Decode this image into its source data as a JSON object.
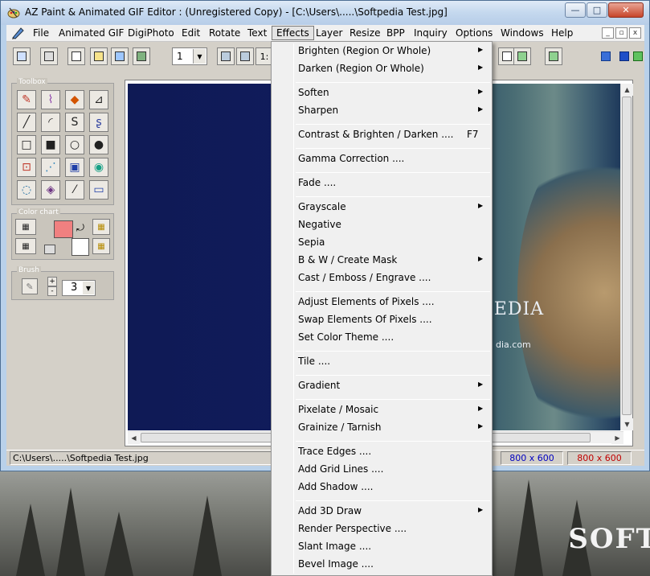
{
  "window": {
    "title": "AZ Paint & Animated GIF Editor : (Unregistered Copy) - [C:\\Users\\.....\\Softpedia Test.jpg]",
    "controls": {
      "minimize": "—",
      "maximize": "□",
      "close": "✕"
    }
  },
  "menubar": {
    "items": [
      "File",
      "Animated GIF",
      "DigiPhoto",
      "Edit",
      "Rotate",
      "Text",
      "Effects",
      "Layer",
      "Resize",
      "BPP",
      "Inquiry",
      "Options",
      "Windows",
      "Help"
    ],
    "active": "Effects",
    "mdi": {
      "minimize": "_",
      "restore": "▫",
      "close": "x"
    }
  },
  "toolbar": {
    "frame_select_value": "1",
    "zoom_label": "1:"
  },
  "panels": {
    "toolbox_label": "Toolbox",
    "color_chart_label": "Color chart",
    "brush_label": "Brush",
    "brush_size": "3",
    "brush_plus": "+",
    "brush_minus": "-",
    "primary_color": "#f08080",
    "secondary_color": "#ffffff"
  },
  "canvas": {
    "watermark_text": "PEDIA",
    "watermark_sub": "dia.com"
  },
  "statusbar": {
    "path": "C:\\Users\\.....\\Softpedia Test.jpg",
    "size_blue": "800 x 600",
    "size_red": "800 x 600"
  },
  "effects_menu": {
    "items": [
      {
        "label": "Brighten   (Region Or Whole)",
        "submenu": true
      },
      {
        "label": "Darken   (Region Or Whole)",
        "submenu": true
      },
      {
        "label": "Soften",
        "submenu": true
      },
      {
        "label": "Sharpen",
        "submenu": true
      },
      {
        "label": "Contrast  & Brighten / Darken ....",
        "shortcut": "F7"
      },
      {
        "label": "Gamma Correction ...."
      },
      {
        "label": "Fade ...."
      },
      {
        "label": "Grayscale",
        "submenu": true
      },
      {
        "label": "Negative"
      },
      {
        "label": "Sepia"
      },
      {
        "label": "B & W / Create Mask",
        "submenu": true
      },
      {
        "label": "Cast / Emboss / Engrave ...."
      },
      {
        "label": "Adjust Elements of Pixels ...."
      },
      {
        "label": "Swap Elements Of Pixels ...."
      },
      {
        "label": "Set Color Theme ...."
      },
      {
        "label": "Tile ...."
      },
      {
        "label": "Gradient",
        "submenu": true
      },
      {
        "label": "Pixelate / Mosaic",
        "submenu": true
      },
      {
        "label": "Grainize / Tarnish",
        "submenu": true
      },
      {
        "label": "Trace Edges ...."
      },
      {
        "label": "Add Grid Lines ...."
      },
      {
        "label": "Add Shadow ...."
      },
      {
        "label": "Add 3D Draw",
        "submenu": true
      },
      {
        "label": "Render Perspective ...."
      },
      {
        "label": "Slant Image ...."
      },
      {
        "label": "Bevel Image ...."
      }
    ],
    "arrow_glyph": "▶"
  },
  "desktop": {
    "watermark": "SOFT"
  },
  "colors": {
    "title_gradient_top": "#dfeaf7",
    "menu_bg": "#f0f0f0",
    "canvas_blue": "#0f1a55",
    "status_blue": "#0000c0",
    "status_red": "#c00000"
  }
}
